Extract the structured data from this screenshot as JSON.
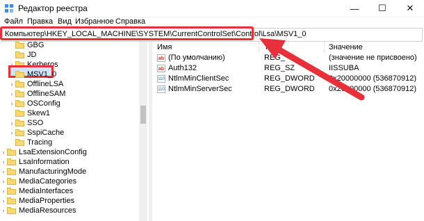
{
  "window": {
    "title": "Редактор реестра",
    "minimize": "—",
    "maximize": "☐",
    "close": "✕"
  },
  "menu": [
    "Файл",
    "Правка",
    "Вид",
    "Избранное",
    "Справка"
  ],
  "address": "Компьютер\\HKEY_LOCAL_MACHINE\\SYSTEM\\CurrentControlSet\\Control\\Lsa\\MSV1_0",
  "tree": [
    {
      "label": "GBG",
      "expandable": false
    },
    {
      "label": "JD",
      "expandable": false
    },
    {
      "label": "Kerberos",
      "expandable": true
    },
    {
      "label": "MSV1_0",
      "expandable": false,
      "selected": true
    },
    {
      "label": "OfflineLSA",
      "expandable": true
    },
    {
      "label": "OfflineSAM",
      "expandable": true
    },
    {
      "label": "OSConfig",
      "expandable": true
    },
    {
      "label": "Skew1",
      "expandable": false
    },
    {
      "label": "SSO",
      "expandable": true
    },
    {
      "label": "SspiCache",
      "expandable": true
    },
    {
      "label": "Tracing",
      "expandable": false
    },
    {
      "label": "LsaExtensionConfig",
      "expandable": true
    },
    {
      "label": "LsaInformation",
      "expandable": true
    },
    {
      "label": "ManufacturingMode",
      "expandable": true
    },
    {
      "label": "MediaCategories",
      "expandable": true
    },
    {
      "label": "MediaInterfaces",
      "expandable": true
    },
    {
      "label": "MediaProperties",
      "expandable": true
    },
    {
      "label": "MediaResources",
      "expandable": true
    }
  ],
  "columns": {
    "name": "Имя",
    "type": "Тип",
    "data": "Значение"
  },
  "values": [
    {
      "icon": "string-value-icon",
      "glyph": "ab",
      "name": "(По умолчанию)",
      "type": "REG_",
      "data": "(значение не присвоено)"
    },
    {
      "icon": "string-value-icon",
      "glyph": "ab",
      "name": "Auth132",
      "type": "REG_SZ",
      "data": "IISSUBA"
    },
    {
      "icon": "dword-value-icon",
      "glyph": "110",
      "name": "NtlmMinClientSec",
      "type": "REG_DWORD",
      "data": "0x20000000 (536870912)"
    },
    {
      "icon": "dword-value-icon",
      "glyph": "110",
      "name": "NtlmMinServerSec",
      "type": "REG_DWORD",
      "data": "0x20000000 (536870912)"
    }
  ],
  "colors": {
    "highlight": "#e8303a",
    "selection": "#cce8ff",
    "folder": "#f8d775"
  }
}
